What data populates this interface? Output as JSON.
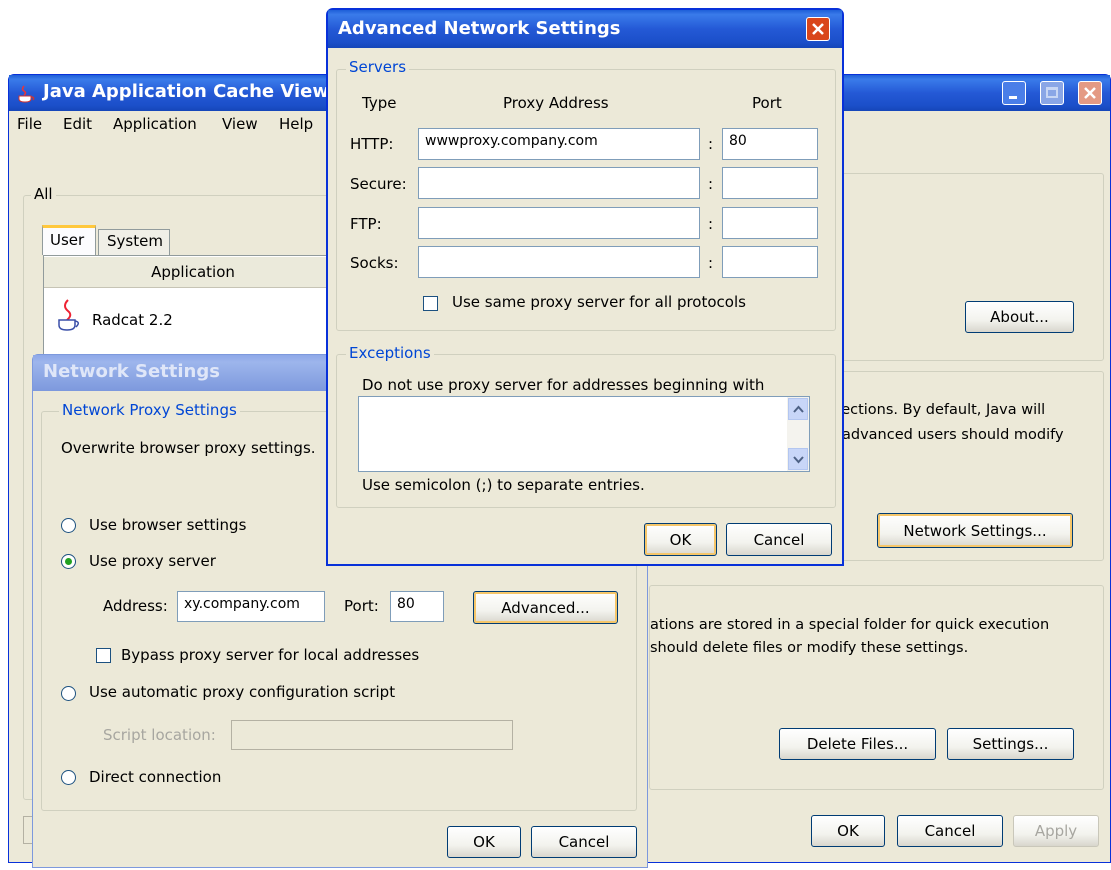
{
  "main": {
    "title": "Java Application Cache Viewer",
    "menu": [
      "File",
      "Edit",
      "Application",
      "View",
      "Help"
    ],
    "group_all": "All",
    "tabs": [
      "User",
      "System"
    ],
    "table_header": "Application",
    "row_app": "Radcat 2.2",
    "about": "About...",
    "network_text_1": "nections.  By default, Java will",
    "network_text_2": "advanced users should modify",
    "network_settings": "Network Settings...",
    "temp_text_1": "ations are stored in a special folder for quick execution",
    "temp_text_2": " should delete files or modify these settings.",
    "delete_files": "Delete Files...",
    "settings": "Settings...",
    "ok": "OK",
    "cancel": "Cancel",
    "apply": "Apply"
  },
  "network": {
    "title": "Network Settings",
    "group": "Network Proxy Settings",
    "desc": "Overwrite browser proxy settings.",
    "use_browser": "Use browser settings",
    "use_proxy": "Use proxy server",
    "address_label": "Address:",
    "address_value": "xy.company.com",
    "port_label": "Port:",
    "port_value": "80",
    "advanced": "Advanced...",
    "bypass": "Bypass proxy server for local addresses",
    "auto_script": "Use automatic proxy configuration script",
    "script_label": "Script location:",
    "direct": "Direct connection",
    "ok": "OK",
    "cancel": "Cancel"
  },
  "advanced": {
    "title": "Advanced Network Settings",
    "servers": "Servers",
    "col_type": "Type",
    "col_address": "Proxy Address",
    "col_port": "Port",
    "rows": [
      {
        "type": "HTTP:",
        "address": "wwwproxy.company.com",
        "port": "80"
      },
      {
        "type": "Secure:",
        "address": "",
        "port": ""
      },
      {
        "type": "FTP:",
        "address": "",
        "port": ""
      },
      {
        "type": "Socks:",
        "address": "",
        "port": ""
      }
    ],
    "colon": ":",
    "same_proxy": "Use same proxy server for all protocols",
    "exceptions": "Exceptions",
    "exc_desc": "Do not use proxy server for addresses beginning with",
    "exc_hint": "Use semicolon (;) to separate entries.",
    "ok": "OK",
    "cancel": "Cancel"
  },
  "icons": {
    "java": "java-cup-icon",
    "close": "close-icon",
    "minimize": "minimize-icon",
    "maximize": "maximize-icon",
    "scroll_up": "chevron-up-icon",
    "scroll_down": "chevron-down-icon"
  },
  "colors": {
    "titlebar": "#2459d6",
    "window_bg": "#ece9d8",
    "legend": "#0046d5",
    "close_button": "#d9461b"
  }
}
